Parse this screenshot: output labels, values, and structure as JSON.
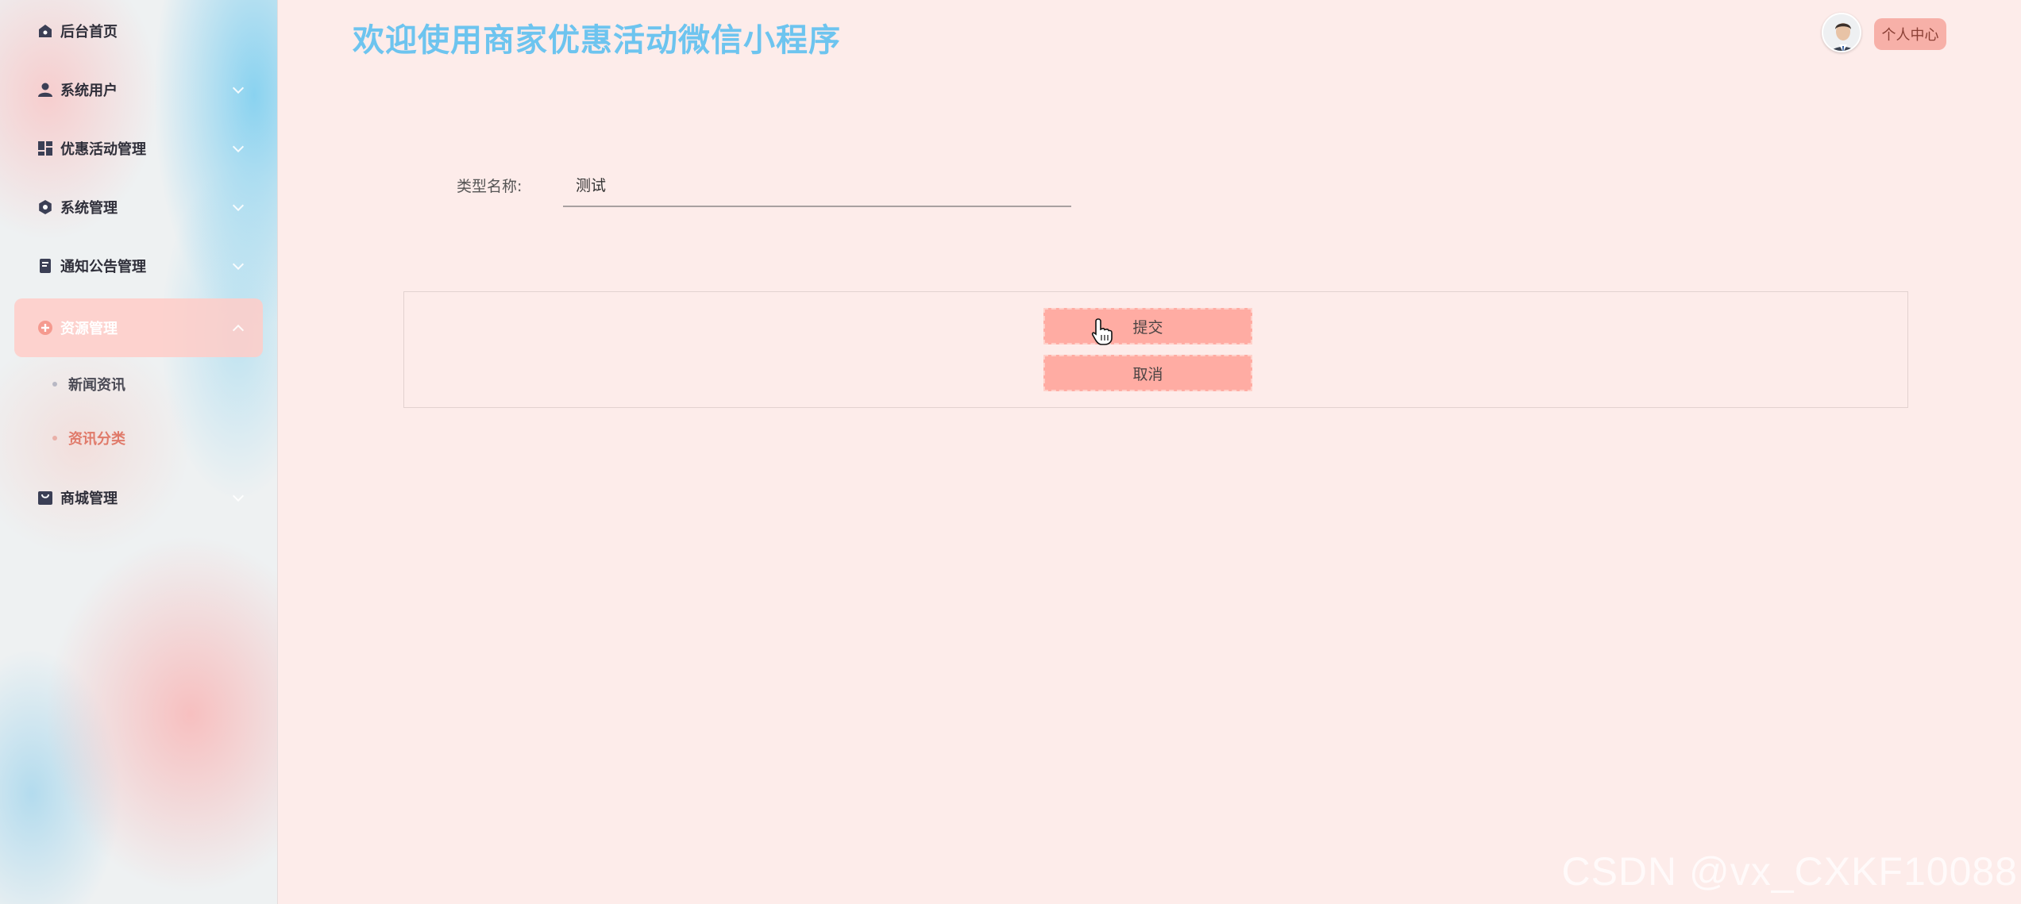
{
  "header": {
    "title": "欢迎使用商家优惠活动微信小程序",
    "profile_button": "个人中心",
    "avatar_icon": "user-portrait-icon"
  },
  "sidebar": {
    "items": [
      {
        "label": "后台首页",
        "icon": "home-icon"
      },
      {
        "label": "系统用户",
        "icon": "user-icon"
      },
      {
        "label": "优惠活动管理",
        "icon": "dashboard-icon"
      },
      {
        "label": "系统管理",
        "icon": "gear-icon"
      },
      {
        "label": "通知公告管理",
        "icon": "document-icon"
      },
      {
        "label": "资源管理",
        "icon": "plus-circle-icon",
        "expanded": true,
        "children": [
          {
            "label": "新闻资讯"
          },
          {
            "label": "资讯分类",
            "current": true
          }
        ]
      },
      {
        "label": "商城管理",
        "icon": "shop-icon"
      }
    ]
  },
  "form": {
    "type_name_label": "类型名称:",
    "type_name_value": "测试"
  },
  "actions": {
    "submit": "提交",
    "cancel": "取消"
  },
  "watermark": "CSDN @vx_CXKF10088",
  "colors": {
    "background": "#fdecea",
    "title": "#6dc4ef",
    "button": "#ffaca3",
    "profile_button": "#f7b0a8",
    "current_submenu": "#e07a6a"
  }
}
